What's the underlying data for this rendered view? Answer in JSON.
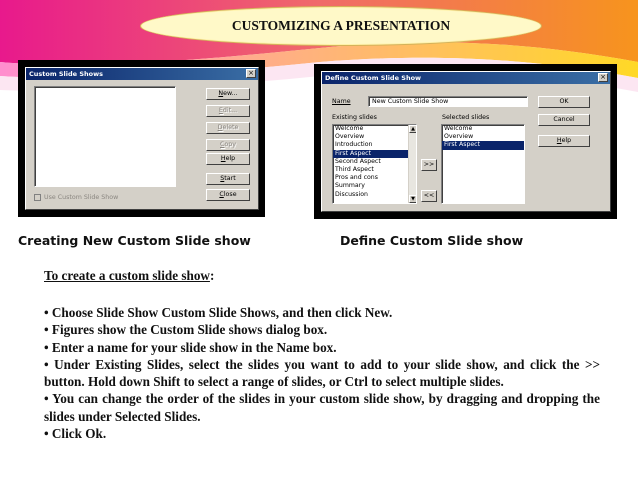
{
  "slide_title": "CUSTOMIZING A PRESENTATION",
  "colors": {
    "magenta": "#e8198c",
    "orange": "#f7941d",
    "yellow": "#fff200",
    "pill_fill": "#fff9c8"
  },
  "dialog_custom_slide_shows": {
    "title": "Custom Slide Shows",
    "close_glyph": "×",
    "buttons": [
      {
        "label": "New...",
        "underline": "N",
        "disabled": false
      },
      {
        "label": "Edit...",
        "underline": "E",
        "disabled": true
      },
      {
        "label": "Delete",
        "underline": "D",
        "disabled": true
      },
      {
        "label": "Copy",
        "underline": "C",
        "disabled": true
      },
      {
        "label": "Help",
        "underline": "H",
        "disabled": false
      },
      {
        "label": "Start",
        "underline": "S",
        "disabled": false
      },
      {
        "label": "Close",
        "underline": "C",
        "disabled": false
      }
    ],
    "checkbox_label": "Use Custom Slide Show"
  },
  "dialog_define_custom_slide_show": {
    "title": "Define Custom Slide Show",
    "close_glyph": "×",
    "name_label": "Name",
    "name_value": "New Custom Slide Show",
    "existing_label": "Existing slides",
    "selected_label": "Selected slides",
    "existing_slides": [
      "Welcome",
      "Overview",
      "Introduction",
      "First Aspect",
      "Second Aspect",
      "Third Aspect",
      "Pros and cons",
      "Summary",
      "Discussion"
    ],
    "existing_selected_index": 3,
    "selected_slides": [
      "Welcome",
      "Overview",
      "First Aspect"
    ],
    "selected_highlight_index": 2,
    "add_button": ">>",
    "remove_button": "<<",
    "ok_button": "OK",
    "cancel_button": "Cancel",
    "help_button": "Help"
  },
  "captions": {
    "left": "Creating New Custom Slide show",
    "right": "Define Custom Slide show"
  },
  "content": {
    "heading": "To create a custom slide show",
    "heading_suffix": ":",
    "bullets": [
      "• Choose Slide Show  Custom Slide Shows, and then click New.",
      "• Figures show the Custom Slide shows dialog box.",
      "• Enter a name for your slide show in the Name box.",
      "• Under Existing Slides, select the slides you want to add to your slide show, and click the >> button. Hold down Shift to select a range of slides, or Ctrl to select multiple slides.",
      "• You can change the order of the slides in your custom slide show, by dragging and dropping the slides under Selected Slides.",
      "• Click Ok."
    ]
  }
}
